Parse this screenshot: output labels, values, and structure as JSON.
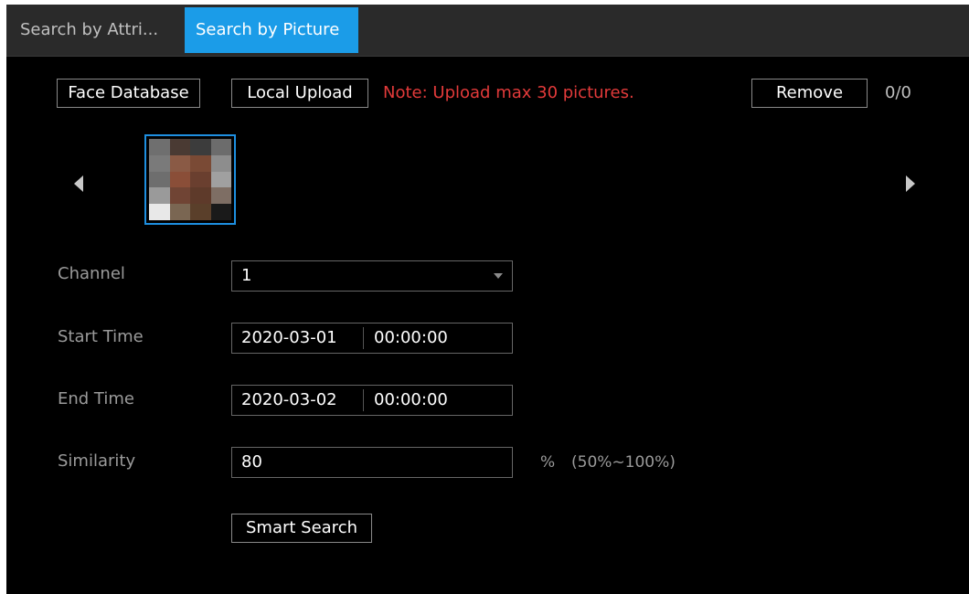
{
  "tabs": [
    {
      "label": "Search by Attri...",
      "active": false
    },
    {
      "label": "Search by Picture",
      "active": true
    }
  ],
  "toolbar": {
    "face_database_label": "Face Database",
    "local_upload_label": "Local Upload",
    "note": "Note: Upload max 30 pictures.",
    "remove_label": "Remove",
    "count": "0/0"
  },
  "form": {
    "channel": {
      "label": "Channel",
      "value": "1"
    },
    "start_time": {
      "label": "Start Time",
      "date": "2020-03-01",
      "time": "00:00:00"
    },
    "end_time": {
      "label": "End Time",
      "date": "2020-03-02",
      "time": "00:00:00"
    },
    "similarity": {
      "label": "Similarity",
      "value": "80",
      "unit": "%",
      "range": "(50%~100%)"
    }
  },
  "actions": {
    "smart_search_label": "Smart Search"
  },
  "icons": {
    "prev": "chevron-left-icon",
    "next": "chevron-right-icon"
  },
  "colors": {
    "accent": "#1b9ce8",
    "note": "#e23a3a",
    "thumbnail_mosaic": [
      "#6f6f6f",
      "#4a3a33",
      "#3c3c3c",
      "#6c6c6c",
      "#7a7a7a",
      "#8a5a45",
      "#7a4a35",
      "#8d8d8d",
      "#6e6e6e",
      "#8a4e38",
      "#6a3f2f",
      "#a0a0a0",
      "#9a9a9a",
      "#704434",
      "#5e3a2a",
      "#7e6e64",
      "#e8e8e8",
      "#7a6652",
      "#5a3f2a",
      "#1a1a1a"
    ]
  }
}
